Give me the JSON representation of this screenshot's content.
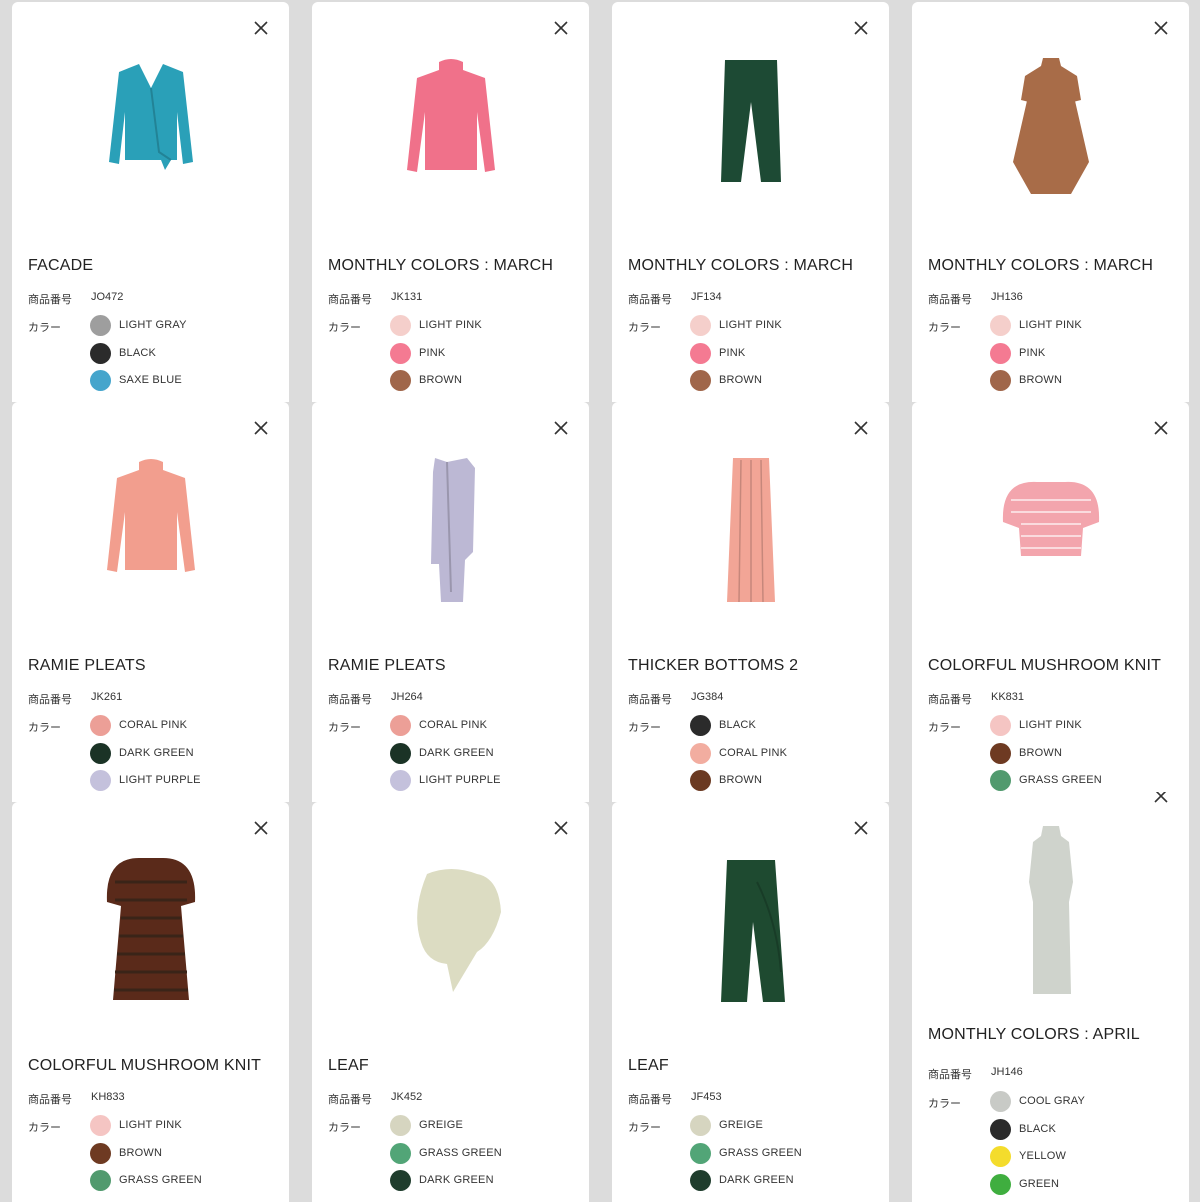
{
  "labels": {
    "item_no": "商品番号",
    "color": "カラー"
  },
  "products": [
    {
      "title": "FACADE",
      "code": "JO472",
      "garment": "cardigan",
      "garment_color": "#2aa0b8",
      "colors": [
        {
          "name": "LIGHT GRAY",
          "hex": "#9e9e9e"
        },
        {
          "name": "BLACK",
          "hex": "#2b2b2b"
        },
        {
          "name": "SAXE BLUE",
          "hex": "#45a5cc"
        }
      ]
    },
    {
      "title": "MONTHLY COLORS : MARCH",
      "code": "JK131",
      "garment": "top",
      "garment_color": "#f0718a",
      "colors": [
        {
          "name": "LIGHT PINK",
          "hex": "#f5cfcb"
        },
        {
          "name": "PINK",
          "hex": "#f47a92"
        },
        {
          "name": "BROWN",
          "hex": "#a0664a"
        }
      ]
    },
    {
      "title": "MONTHLY COLORS : MARCH",
      "code": "JF134",
      "garment": "pants",
      "garment_color": "#1d4a34",
      "colors": [
        {
          "name": "LIGHT PINK",
          "hex": "#f5cfcb"
        },
        {
          "name": "PINK",
          "hex": "#f47a92"
        },
        {
          "name": "BROWN",
          "hex": "#a0664a"
        }
      ]
    },
    {
      "title": "MONTHLY COLORS : MARCH",
      "code": "JH136",
      "garment": "dress",
      "garment_color": "#a86c48",
      "colors": [
        {
          "name": "LIGHT PINK",
          "hex": "#f5cfcb"
        },
        {
          "name": "PINK",
          "hex": "#f47a92"
        },
        {
          "name": "BROWN",
          "hex": "#a0664a"
        }
      ]
    },
    {
      "title": "RAMIE PLEATS",
      "code": "JK261",
      "garment": "top",
      "garment_color": "#f29e8e",
      "colors": [
        {
          "name": "CORAL PINK",
          "hex": "#ec9f97"
        },
        {
          "name": "DARK GREEN",
          "hex": "#1b3326"
        },
        {
          "name": "LIGHT PURPLE",
          "hex": "#c4c1dc"
        }
      ]
    },
    {
      "title": "RAMIE PLEATS",
      "code": "JH264",
      "garment": "vest",
      "garment_color": "#bcb8d4",
      "colors": [
        {
          "name": "CORAL PINK",
          "hex": "#ec9f97"
        },
        {
          "name": "DARK GREEN",
          "hex": "#1b3326"
        },
        {
          "name": "LIGHT PURPLE",
          "hex": "#c4c1dc"
        }
      ]
    },
    {
      "title": "THICKER BOTTOMS 2",
      "code": "JG384",
      "garment": "skirt",
      "garment_color": "#f2a596",
      "colors": [
        {
          "name": "BLACK",
          "hex": "#2b2b2b"
        },
        {
          "name": "CORAL PINK",
          "hex": "#f2ada0"
        },
        {
          "name": "BROWN",
          "hex": "#6b3a22"
        }
      ]
    },
    {
      "title": "COLORFUL MUSHROOM KNIT",
      "code": "KK831",
      "garment": "puff",
      "garment_color": "#f3a5ad",
      "colors": [
        {
          "name": "LIGHT PINK",
          "hex": "#f5c5c3"
        },
        {
          "name": "BROWN",
          "hex": "#6e3a22"
        },
        {
          "name": "GRASS GREEN",
          "hex": "#519a6e"
        }
      ]
    },
    {
      "title": "COLORFUL MUSHROOM KNIT",
      "code": "KH833",
      "garment": "puffdress",
      "garment_color": "#5a2a1a",
      "colors": [
        {
          "name": "LIGHT PINK",
          "hex": "#f5c5c3"
        },
        {
          "name": "BROWN",
          "hex": "#6e3a22"
        },
        {
          "name": "GRASS GREEN",
          "hex": "#519a6e"
        }
      ]
    },
    {
      "title": "LEAF",
      "code": "JK452",
      "garment": "leaftop",
      "garment_color": "#dcdcc2",
      "colors": [
        {
          "name": "GREIGE",
          "hex": "#d6d5c0"
        },
        {
          "name": "GRASS GREEN",
          "hex": "#52a577"
        },
        {
          "name": "DARK GREEN",
          "hex": "#1f3d2d"
        }
      ]
    },
    {
      "title": "LEAF",
      "code": "JF453",
      "garment": "widepants",
      "garment_color": "#1e4a30",
      "colors": [
        {
          "name": "GREIGE",
          "hex": "#d6d5c0"
        },
        {
          "name": "GRASS GREEN",
          "hex": "#52a577"
        },
        {
          "name": "DARK GREEN",
          "hex": "#1f3d2d"
        }
      ]
    },
    {
      "title": "MONTHLY COLORS : APRIL",
      "code": "JH146",
      "garment": "longdress",
      "garment_color": "#cfd3cc",
      "colors": [
        {
          "name": "COOL GRAY",
          "hex": "#c8cac6"
        },
        {
          "name": "BLACK",
          "hex": "#2b2b2b"
        },
        {
          "name": "YELLOW",
          "hex": "#f4dc2c"
        },
        {
          "name": "GREEN",
          "hex": "#3fae3f"
        }
      ]
    }
  ]
}
